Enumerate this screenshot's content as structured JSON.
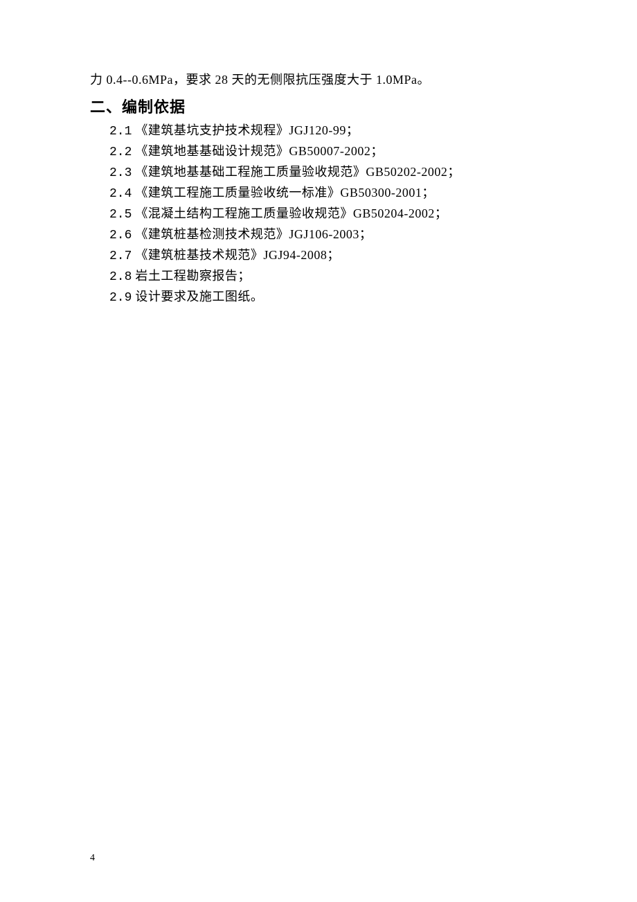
{
  "paragraph": "力 0.4--0.6MPa，要求 28 天的无侧限抗压强度大于 1.0MPa。",
  "heading": "二、编制依据",
  "items": [
    {
      "num": "2.1",
      "text": "《建筑基坑支护技术规程》JGJ120-99；"
    },
    {
      "num": "2.2",
      "text": "《建筑地基基础设计规范》GB50007-2002；"
    },
    {
      "num": "2.3",
      "text": "《建筑地基基础工程施工质量验收规范》GB50202-2002；"
    },
    {
      "num": "2.4",
      "text": "《建筑工程施工质量验收统一标准》GB50300-2001；"
    },
    {
      "num": "2.5",
      "text": "《混凝土结构工程施工质量验收规范》GB50204-2002；"
    },
    {
      "num": "2.6",
      "text": "《建筑桩基检测技术规范》JGJ106-2003；"
    },
    {
      "num": "2.7",
      "text": "《建筑桩基技术规范》JGJ94-2008；"
    },
    {
      "num": "2.8",
      "text": "岩土工程勘察报告；"
    },
    {
      "num": "2.9",
      "text": "设计要求及施工图纸。"
    }
  ],
  "pageNumber": "4"
}
